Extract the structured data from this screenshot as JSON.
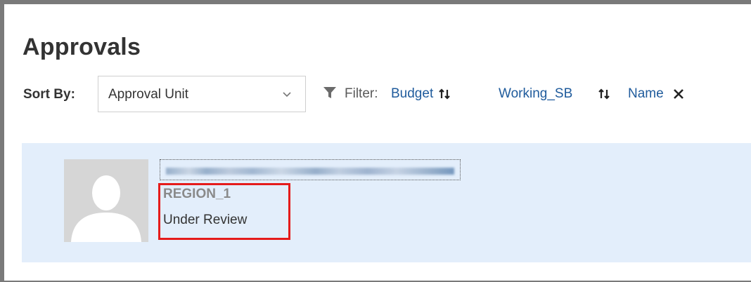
{
  "page": {
    "title": "Approvals"
  },
  "sort": {
    "label": "Sort By:",
    "value": "Approval Unit"
  },
  "filter": {
    "label": "Filter:",
    "chips": [
      {
        "label": "Budget",
        "icon": "swap-icon"
      },
      {
        "label": "Working_SB",
        "icon": "swap-icon"
      },
      {
        "label": "Name",
        "icon": "close-icon"
      }
    ]
  },
  "card": {
    "unit_name": "REGION_1",
    "status": "Under Review"
  },
  "colors": {
    "accent": "#1f5b9c",
    "card_bg": "#e3eefb",
    "highlight": "#e51b1b"
  }
}
